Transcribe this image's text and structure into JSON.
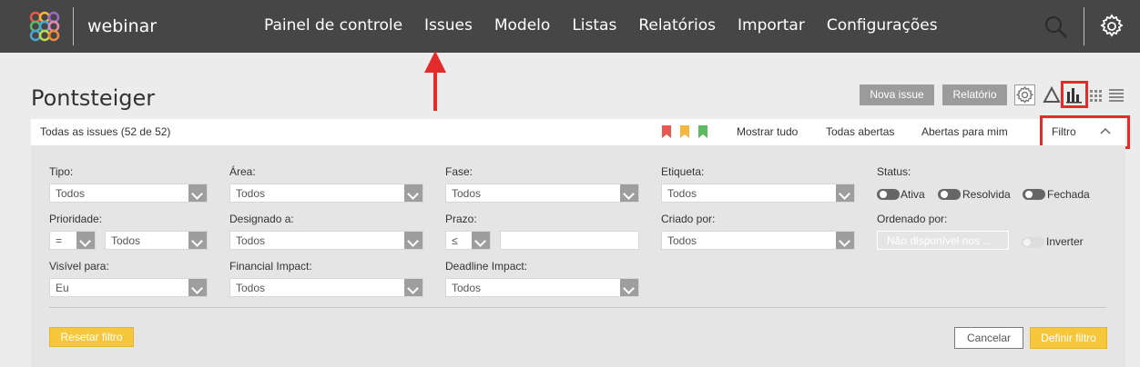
{
  "header": {
    "brand": "webinar",
    "nav": [
      "Painel de controle",
      "Issues",
      "Modelo",
      "Listas",
      "Relatórios",
      "Importar",
      "Configurações"
    ]
  },
  "page": {
    "title": "Pontsteiger",
    "new_issue": "Nova issue",
    "report": "Relatório"
  },
  "issue_bar": {
    "summary": "Todas as issues (52 de 52)",
    "flags": [
      "#e85a4f",
      "#f3b63f",
      "#5dbb63"
    ],
    "show_all": "Mostrar tudo",
    "all_open": "Todas abertas",
    "open_for_me": "Abertas para mim",
    "filter": "Filtro"
  },
  "filters": {
    "tipo": {
      "label": "Tipo:",
      "value": "Todos"
    },
    "area": {
      "label": "Área:",
      "value": "Todos"
    },
    "fase": {
      "label": "Fase:",
      "value": "Todos"
    },
    "etiqueta": {
      "label": "Etiqueta:",
      "value": "Todos"
    },
    "status": {
      "label": "Status:",
      "options": [
        "Ativa",
        "Resolvida",
        "Fechada"
      ]
    },
    "prioridade": {
      "label": "Prioridade:",
      "op": "=",
      "value": "Todos"
    },
    "designado": {
      "label": "Designado a:",
      "value": "Todos"
    },
    "prazo": {
      "label": "Prazo:",
      "op": "≤",
      "value": ""
    },
    "criado": {
      "label": "Criado por:",
      "value": "Todos"
    },
    "ordenado": {
      "label": "Ordenado por:",
      "placeholder": "Não disponível nos ...",
      "invert": "Inverter"
    },
    "visivel": {
      "label": "Visível para:",
      "value": "Eu"
    },
    "financial": {
      "label": "Financial Impact:",
      "value": "Todos"
    },
    "deadline": {
      "label": "Deadline Impact:",
      "value": "Todos"
    }
  },
  "actions": {
    "reset": "Resetar filtro",
    "cancel": "Cancelar",
    "apply": "Definir filtro"
  },
  "colors": {
    "accent": "#f7c73b",
    "header": "#464646",
    "highlight": "#e32b2b"
  }
}
